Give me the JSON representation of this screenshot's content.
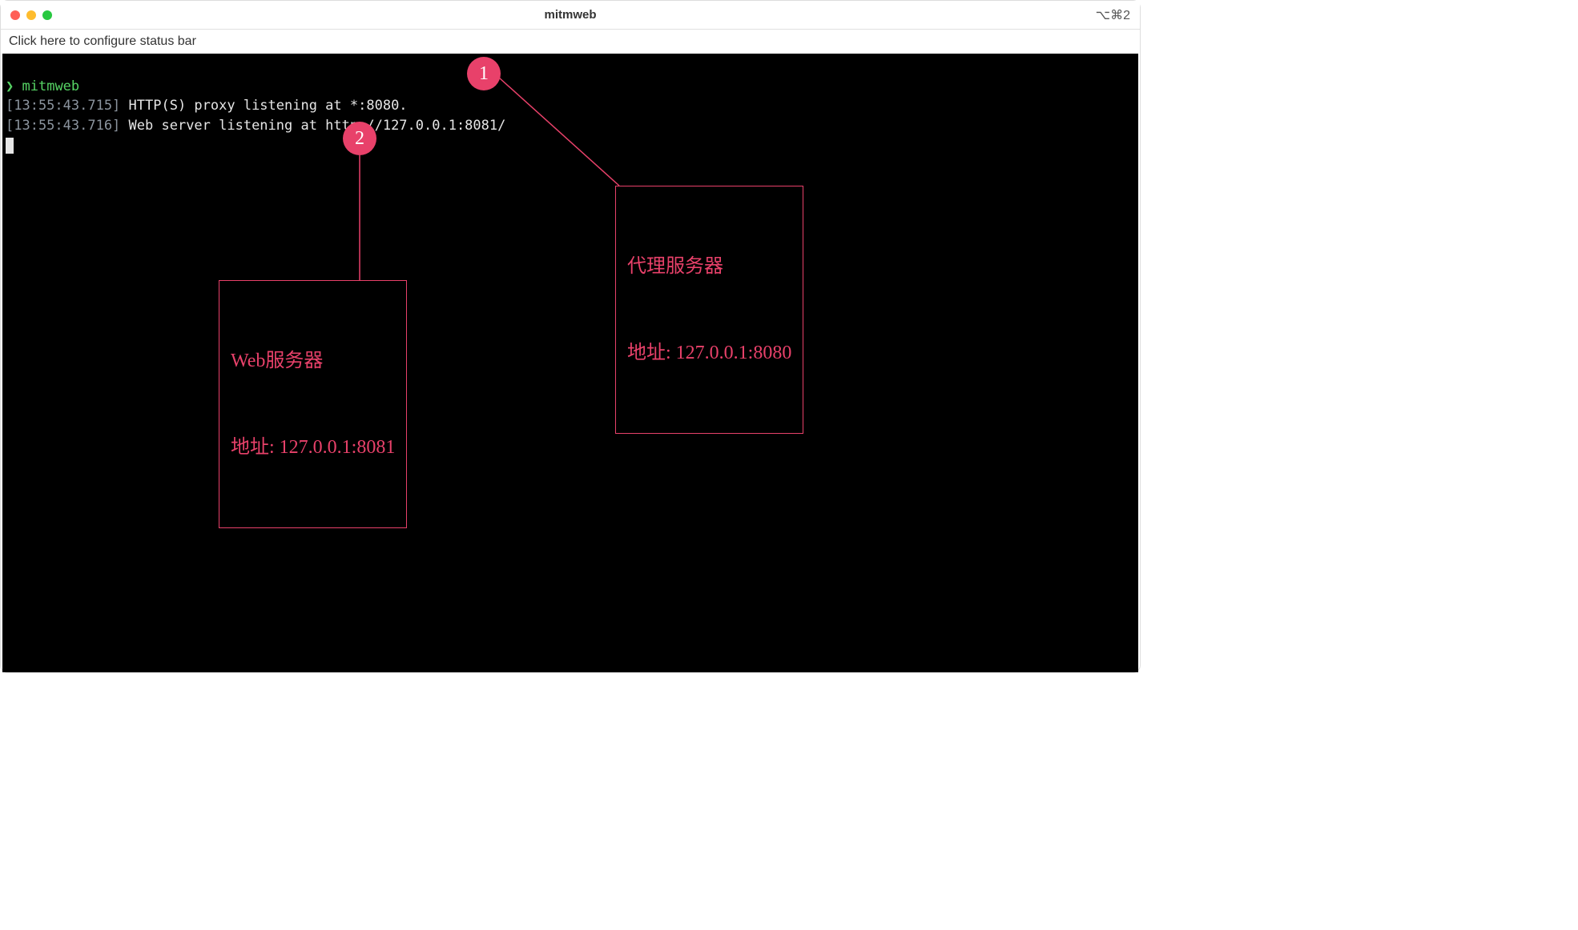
{
  "titlebar": {
    "title": "mitmweb",
    "shortcut": "⌥⌘2"
  },
  "statusbar": {
    "text": "Click here to configure status bar"
  },
  "terminal": {
    "prompt_symbol": "❯",
    "prompt_command": "mitmweb",
    "lines": [
      {
        "timestamp": "[13:55:43.715]",
        "text": "HTTP(S) proxy listening at *:8080."
      },
      {
        "timestamp": "[13:55:43.716]",
        "text": "Web server listening at http://127.0.0.1:8081/"
      }
    ]
  },
  "annotations": {
    "badge1": "1",
    "badge2": "2",
    "box1_line1": "代理服务器",
    "box1_line2": "地址: 127.0.0.1:8080",
    "box2_line1": "Web服务器",
    "box2_line2": "地址: 127.0.0.1:8081"
  }
}
